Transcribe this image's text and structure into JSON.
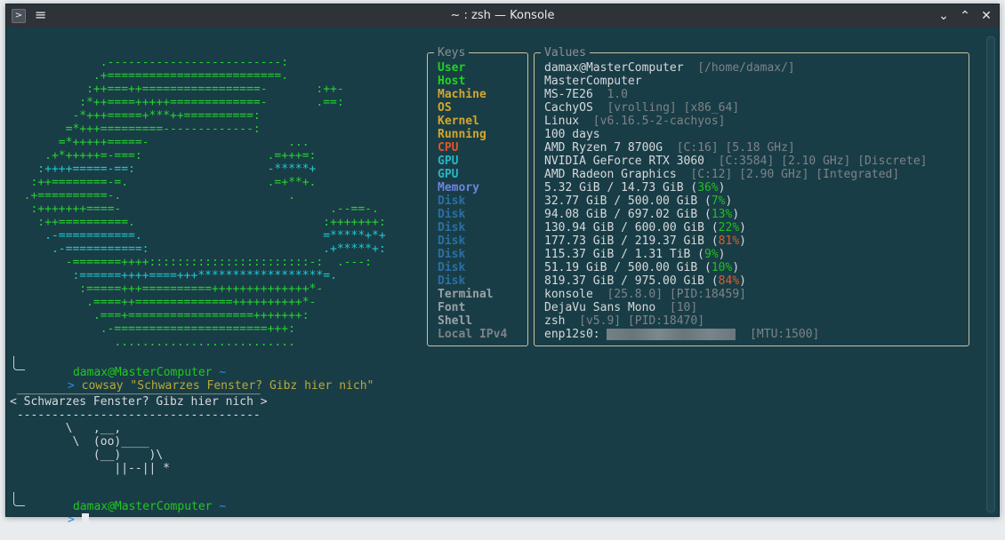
{
  "window": {
    "title": "~ : zsh — Konsole",
    "app_icon_glyph": ">",
    "menu_glyph": "≡",
    "controls": {
      "minimize": "⌄",
      "maximize": "⌃",
      "close": "✕"
    }
  },
  "ascii_art": [
    {
      "text": "             .-------------------------:",
      "color": "green"
    },
    {
      "text": "            .+=========================.",
      "color": "green"
    },
    {
      "text": "           :++===++=================-       :++-",
      "color": "green"
    },
    {
      "text": "          :*++====+++++=============-       .==:",
      "color": "green"
    },
    {
      "text": "         -*+++=====+***++==========:",
      "color": "green"
    },
    {
      "text": "        =*+++=========-------------:",
      "color": "green"
    },
    {
      "text": "       =*+++++=====-                    ...",
      "color": "green"
    },
    {
      "text": "     .+*+++++=-===:                  .=+++=:",
      "color": "green"
    },
    {
      "text": "    :++++=====-==:                   -*****+",
      "color": "cyan"
    },
    {
      "text": "   :++========-=.                    .=+**+.",
      "color": "green"
    },
    {
      "text": "  .+==========-.                        .",
      "color": "green"
    },
    {
      "text": "   :+++++++====-                              .--==-.",
      "color": "green"
    },
    {
      "text": "    :++==========.                           :+++++++:",
      "color": "green"
    },
    {
      "text": "     .-===========.                          =*****+*+",
      "color": "cyan"
    },
    {
      "text": "      .-===========:                         .+*****+:",
      "color": "cyan"
    },
    {
      "text": "        -=======++++:::::::::::::::::::::::-:  .---:",
      "color": "green"
    },
    {
      "text": "         :======++++====+++******************=.",
      "color": "cyan"
    },
    {
      "text": "          :=====+++==========++++++++++++++*-",
      "color": "green"
    },
    {
      "text": "           .====++==============++++++++++*-",
      "color": "green"
    },
    {
      "text": "            .===+==================+++++++:",
      "color": "green"
    },
    {
      "text": "             .-======================+++:",
      "color": "green"
    },
    {
      "text": "               ..........................",
      "color": "green"
    }
  ],
  "keys": {
    "legend": "Keys",
    "items": [
      {
        "label": "User",
        "color": "#1fd21f"
      },
      {
        "label": "Host",
        "color": "#1fd21f"
      },
      {
        "label": "Machine",
        "color": "#d4a72c"
      },
      {
        "label": "OS",
        "color": "#d4a72c"
      },
      {
        "label": "Kernel",
        "color": "#d4a72c"
      },
      {
        "label": "Running",
        "color": "#d4a72c"
      },
      {
        "label": "CPU",
        "color": "#e0562a"
      },
      {
        "label": "GPU",
        "color": "#27b6c4"
      },
      {
        "label": "GPU",
        "color": "#27b6c4"
      },
      {
        "label": "Memory",
        "color": "#6d84e0"
      },
      {
        "label": "Disk",
        "color": "#2a6fa3"
      },
      {
        "label": "Disk",
        "color": "#2a6fa3"
      },
      {
        "label": "Disk",
        "color": "#2a6fa3"
      },
      {
        "label": "Disk",
        "color": "#2a6fa3"
      },
      {
        "label": "Disk",
        "color": "#2a6fa3"
      },
      {
        "label": "Disk",
        "color": "#2a6fa3"
      },
      {
        "label": "Disk",
        "color": "#2a6fa3"
      },
      {
        "label": "Terminal",
        "color": "#9aa1a6"
      },
      {
        "label": "Font",
        "color": "#9aa1a6"
      },
      {
        "label": "Shell",
        "color": "#9aa1a6"
      },
      {
        "label": "Local IPv4",
        "color": "#7d8388"
      }
    ]
  },
  "values": {
    "legend": "Values",
    "items": [
      [
        {
          "t": "damax@MasterComputer  "
        },
        {
          "t": "[/home/damax/]",
          "c": "dim"
        }
      ],
      [
        {
          "t": "MasterComputer"
        }
      ],
      [
        {
          "t": "MS-7E26  "
        },
        {
          "t": "1.0",
          "c": "dim"
        }
      ],
      [
        {
          "t": "CachyOS  "
        },
        {
          "t": "[vrolling] [x86_64]",
          "c": "dim"
        }
      ],
      [
        {
          "t": "Linux  "
        },
        {
          "t": "[v6.16.5-2-cachyos]",
          "c": "dim"
        }
      ],
      [
        {
          "t": "100 days"
        }
      ],
      [
        {
          "t": "AMD Ryzen 7 8700G  "
        },
        {
          "t": "[C:16] [5.18 GHz]",
          "c": "dim"
        }
      ],
      [
        {
          "t": "NVIDIA GeForce RTX 3060  "
        },
        {
          "t": "[C:3584] [2.10 GHz] [Discrete]",
          "c": "dim"
        }
      ],
      [
        {
          "t": "AMD Radeon Graphics  "
        },
        {
          "t": "[C:12] [2.90 GHz] [Integrated]",
          "c": "dim"
        }
      ],
      [
        {
          "t": "5.32 GiB / 14.73 GiB ("
        },
        {
          "t": "36%",
          "c": "green"
        },
        {
          "t": ")"
        }
      ],
      [
        {
          "t": "32.77 GiB / 500.00 GiB ("
        },
        {
          "t": "7%",
          "c": "green"
        },
        {
          "t": ")"
        }
      ],
      [
        {
          "t": "94.08 GiB / 697.02 GiB ("
        },
        {
          "t": "13%",
          "c": "green"
        },
        {
          "t": ")"
        }
      ],
      [
        {
          "t": "130.94 GiB / 600.00 GiB ("
        },
        {
          "t": "22%",
          "c": "green"
        },
        {
          "t": ")"
        }
      ],
      [
        {
          "t": "177.73 GiB / 219.37 GiB ("
        },
        {
          "t": "81%",
          "c": "orange"
        },
        {
          "t": ")"
        }
      ],
      [
        {
          "t": "115.37 GiB / 1.31 TiB ("
        },
        {
          "t": "9%",
          "c": "green"
        },
        {
          "t": ")"
        }
      ],
      [
        {
          "t": "51.19 GiB / 500.00 GiB ("
        },
        {
          "t": "10%",
          "c": "green"
        },
        {
          "t": ")"
        }
      ],
      [
        {
          "t": "819.37 GiB / 975.00 GiB ("
        },
        {
          "t": "84%",
          "c": "orange"
        },
        {
          "t": ")"
        }
      ],
      [
        {
          "t": "konsole  "
        },
        {
          "t": "[25.8.0] [PID:18459]",
          "c": "dim"
        }
      ],
      [
        {
          "t": "DejaVu Sans Mono  "
        },
        {
          "t": "[10]",
          "c": "dim"
        }
      ],
      [
        {
          "t": "zsh  "
        },
        {
          "t": "[v5.9] [PID:18470]",
          "c": "dim"
        }
      ],
      [
        {
          "t": "enp12s0: "
        },
        {
          "t": "",
          "c": "blur"
        },
        {
          "t": "  [MTU:1500]",
          "c": "dim"
        }
      ]
    ]
  },
  "prompt1": {
    "user_host": "damax@MasterComputer",
    "cwd": "~",
    "arrow": ">",
    "command": "cowsay \"Schwarzes Fenster? Gibz hier nich\""
  },
  "cowsay": [
    " ___________________________________",
    "< Schwarzes Fenster? Gibz hier nich >",
    " -----------------------------------",
    "        \\   ^__^",
    "         \\  (oo)\\_______",
    "            (__)\\       )\\/\\",
    "                ||----w |",
    "                ||     ||"
  ],
  "cowsay_rendered": [
    " ___________________________________",
    "< Schwarzes Fenster? Gibz hier nich >",
    " -----------------------------------",
    "        \\   ,__,",
    "         \\  (oo)____",
    "            (__)    )\\",
    "               ||--|| *"
  ],
  "prompt2": {
    "user_host": "damax@MasterComputer",
    "cwd": "~",
    "arrow": ">"
  }
}
